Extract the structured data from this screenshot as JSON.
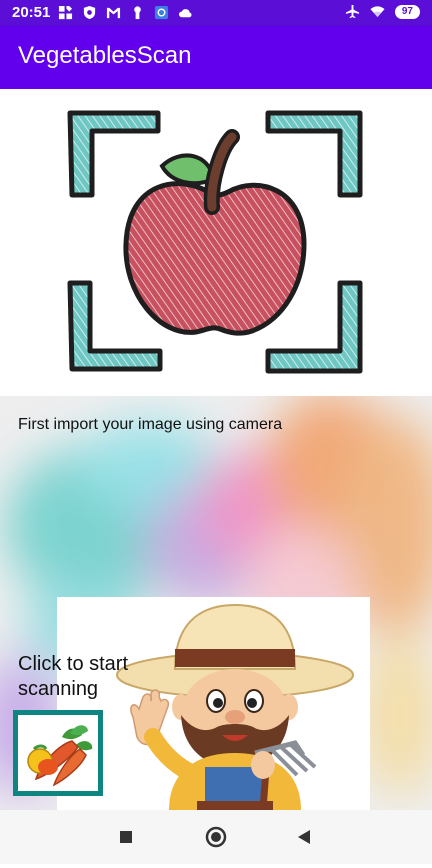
{
  "status_bar": {
    "time": "20:51",
    "battery": "97",
    "left_icons": [
      "app-grid-icon",
      "shield-icon",
      "gmail-icon",
      "keyhole-icon",
      "photo-icon",
      "cloud-icon"
    ],
    "right_icons": [
      "airplane-mode-icon",
      "wifi-icon",
      "battery-icon"
    ]
  },
  "app_bar": {
    "title": "VegetablesScan"
  },
  "hero": {
    "image": "apple-scan-frame-illustration",
    "colors": {
      "apple": "#c8515f",
      "frame": "#6fc7c4",
      "leaf": "#6fbf6d",
      "stem": "#6b3e2f"
    }
  },
  "main": {
    "instruction": "First import your image using camera",
    "start_label": "Click to start scanning",
    "farmer_image": "cartoon-farmer-with-pitchfork",
    "scan_button_image": "vegetables-icon"
  },
  "nav_bar": {
    "icons": [
      "recents-icon",
      "home-icon",
      "back-icon"
    ]
  },
  "colors": {
    "status_bar": "#5b0fd6",
    "app_bar": "#6200ee",
    "button_border": "#0e8580"
  }
}
